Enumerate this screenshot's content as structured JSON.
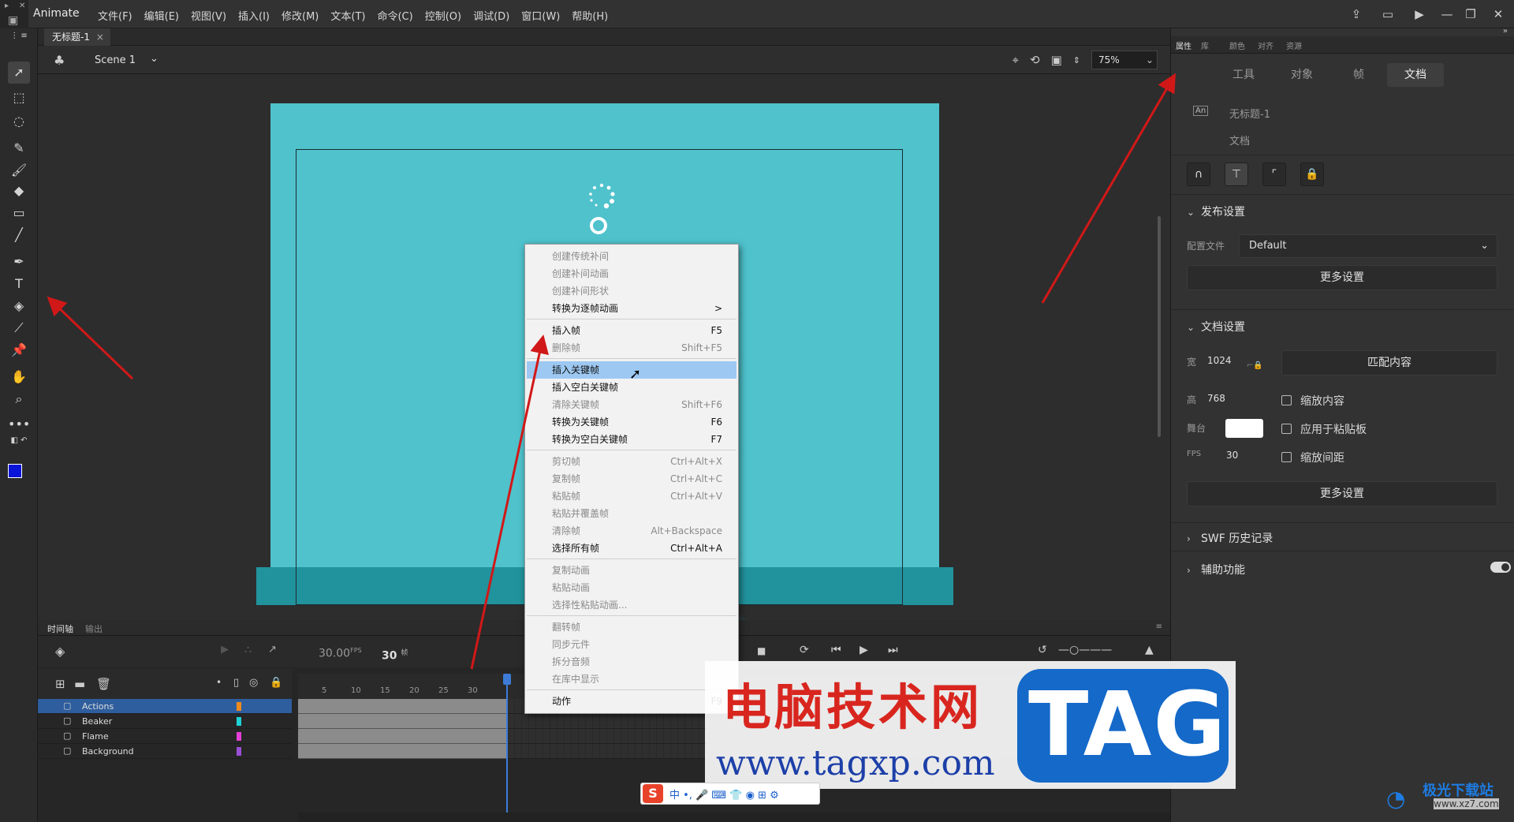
{
  "app": {
    "name": "Animate",
    "menu": [
      "文件(F)",
      "编辑(E)",
      "视图(V)",
      "插入(I)",
      "修改(M)",
      "文本(T)",
      "命令(C)",
      "控制(O)",
      "调试(D)",
      "窗口(W)",
      "帮助(H)"
    ]
  },
  "document": {
    "tab_title": "无标题-1",
    "scene": "Scene 1",
    "zoom": "75%"
  },
  "timeline": {
    "tab_timeline": "时间轴",
    "tab_output": "输出",
    "fps": "30.00",
    "fps_unit": "FPS",
    "current_frame": "30",
    "frame_unit": "帧",
    "ruler_ticks": [
      "5",
      "10",
      "15",
      "20",
      "25",
      "30"
    ],
    "layers": [
      {
        "name": "Actions",
        "color": "#f28a1c",
        "selected": true
      },
      {
        "name": "Beaker",
        "color": "#1fd2d6",
        "selected": false
      },
      {
        "name": "Flame",
        "color": "#e23fd6",
        "selected": false
      },
      {
        "name": "Background",
        "color": "#9a4fd6",
        "selected": false
      }
    ]
  },
  "context_menu": {
    "groups": [
      [
        {
          "label": "创建传统补间",
          "shortcut": "",
          "enabled": false
        },
        {
          "label": "创建补间动画",
          "shortcut": "",
          "enabled": false
        },
        {
          "label": "创建补间形状",
          "shortcut": "",
          "enabled": false
        },
        {
          "label": "转换为逐帧动画",
          "shortcut": ">",
          "enabled": true
        }
      ],
      [
        {
          "label": "插入帧",
          "shortcut": "F5",
          "enabled": true
        },
        {
          "label": "删除帧",
          "shortcut": "Shift+F5",
          "enabled": false
        }
      ],
      [
        {
          "label": "插入关键帧",
          "shortcut": "",
          "enabled": true,
          "highlighted": true
        },
        {
          "label": "插入空白关键帧",
          "shortcut": "",
          "enabled": true
        },
        {
          "label": "清除关键帧",
          "shortcut": "Shift+F6",
          "enabled": false
        },
        {
          "label": "转换为关键帧",
          "shortcut": "F6",
          "enabled": true
        },
        {
          "label": "转换为空白关键帧",
          "shortcut": "F7",
          "enabled": true
        }
      ],
      [
        {
          "label": "剪切帧",
          "shortcut": "Ctrl+Alt+X",
          "enabled": false
        },
        {
          "label": "复制帧",
          "shortcut": "Ctrl+Alt+C",
          "enabled": false
        },
        {
          "label": "粘贴帧",
          "shortcut": "Ctrl+Alt+V",
          "enabled": false
        },
        {
          "label": "粘贴并覆盖帧",
          "shortcut": "",
          "enabled": false
        },
        {
          "label": "清除帧",
          "shortcut": "Alt+Backspace",
          "enabled": false
        },
        {
          "label": "选择所有帧",
          "shortcut": "Ctrl+Alt+A",
          "enabled": true
        }
      ],
      [
        {
          "label": "复制动画",
          "shortcut": "",
          "enabled": false
        },
        {
          "label": "粘贴动画",
          "shortcut": "",
          "enabled": false
        },
        {
          "label": "选择性粘贴动画...",
          "shortcut": "",
          "enabled": false
        }
      ],
      [
        {
          "label": "翻转帧",
          "shortcut": "",
          "enabled": false
        },
        {
          "label": "同步元件",
          "shortcut": "",
          "enabled": false
        },
        {
          "label": "拆分音频",
          "shortcut": "",
          "enabled": false
        },
        {
          "label": "在库中显示",
          "shortcut": "",
          "enabled": false
        }
      ],
      [
        {
          "label": "动作",
          "shortcut": "F9",
          "enabled": true
        }
      ]
    ]
  },
  "properties": {
    "tabs": [
      "属性",
      "库",
      "颜色",
      "对齐",
      "资源"
    ],
    "segments": [
      "工具",
      "对象",
      "帧",
      "文档"
    ],
    "active_segment": "文档",
    "doc_name": "无标题-1",
    "doc_type": "文档",
    "publish_section": "发布设置",
    "profile_label": "配置文件",
    "profile_value": "Default",
    "more_settings": "更多设置",
    "doc_section": "文档设置",
    "width_label": "宽",
    "width_value": "1024",
    "height_label": "高",
    "height_value": "768",
    "match_contents": "匹配内容",
    "stage_label": "舞台",
    "stage_color": "#ffffff",
    "fps_label": "FPS",
    "fps_value": "30",
    "scale_content": "缩放内容",
    "apply_pasteboard": "应用于粘贴板",
    "scale_spacing": "缩放间距",
    "more_settings_2": "更多设置",
    "swf_history": "SWF 历史记录",
    "accessibility": "辅助功能"
  },
  "colors": {
    "stage": "#4fc2cc",
    "stage_floor": "#21939c",
    "arrow": "#d11818",
    "fill_swatch": "#0a14d8"
  },
  "watermark": {
    "title": "电脑技术网",
    "url": "www.tagxp.com",
    "tag": "TAG",
    "site_name": "极光下载站",
    "site_url": "www.xz7.com"
  }
}
